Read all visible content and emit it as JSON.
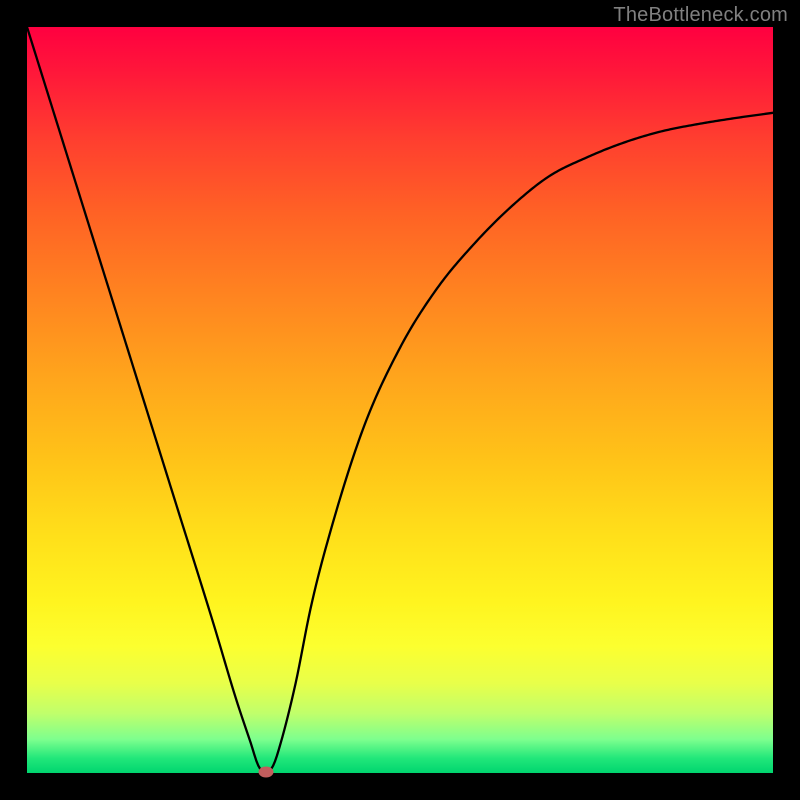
{
  "watermark": "TheBottleneck.com",
  "chart_data": {
    "type": "line",
    "title": "",
    "xlabel": "",
    "ylabel": "",
    "xlim": [
      0,
      100
    ],
    "ylim": [
      0,
      100
    ],
    "x": [
      0,
      5,
      10,
      15,
      20,
      25,
      28,
      30,
      31,
      32,
      33,
      34,
      36,
      38,
      40,
      45,
      50,
      55,
      60,
      65,
      70,
      75,
      80,
      85,
      90,
      95,
      100
    ],
    "y": [
      100,
      84,
      68,
      52,
      36,
      20,
      10,
      4,
      1,
      0,
      1,
      4,
      12,
      22,
      30,
      46,
      57,
      65,
      71,
      76,
      80,
      82.5,
      84.5,
      86,
      87,
      87.8,
      88.5
    ],
    "min_point": {
      "x": 32,
      "y": 0
    },
    "background_gradient": {
      "top": "#ff0040",
      "mid1": "#ff8420",
      "mid2": "#ffdf1a",
      "bottom": "#00d56f"
    },
    "curve_color": "#000000",
    "min_marker_color": "#c15d5d"
  }
}
